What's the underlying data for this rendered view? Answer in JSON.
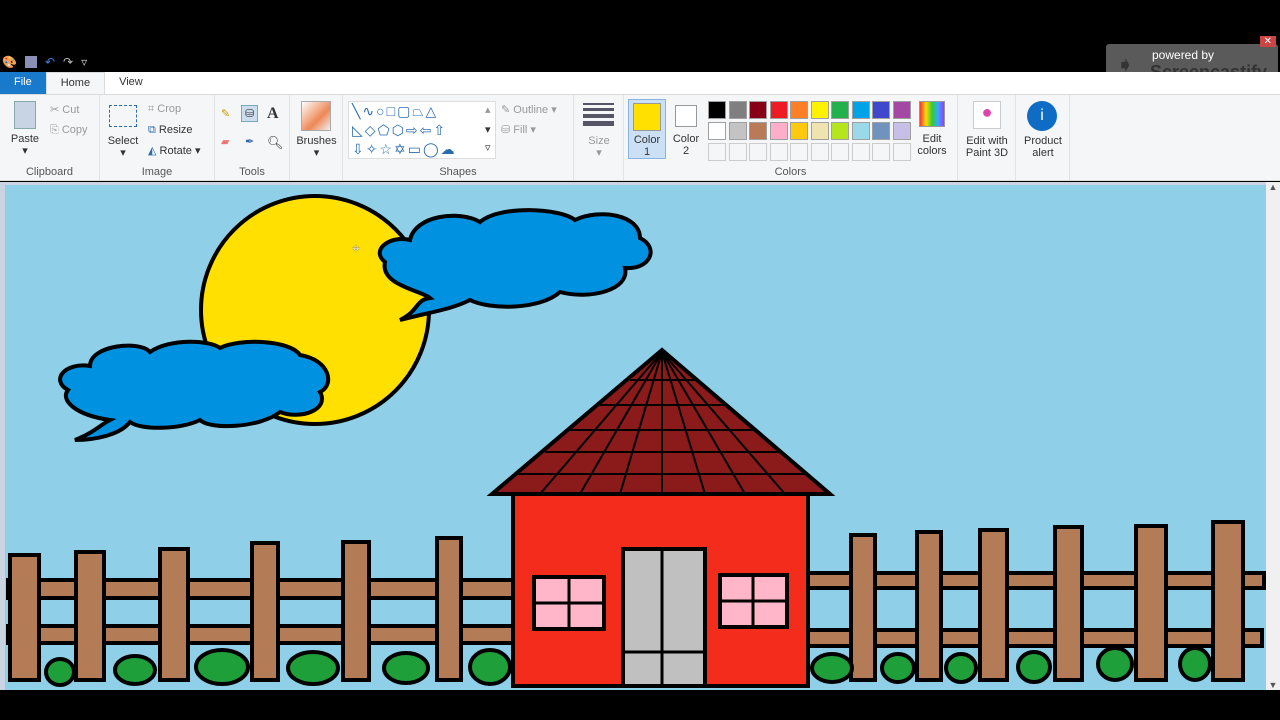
{
  "quick_access": {
    "icons": [
      "paint-app-icon",
      "save-icon",
      "undo-icon",
      "redo-icon",
      "customize-icon"
    ]
  },
  "tabs": [
    {
      "label": "File"
    },
    {
      "label": "Home"
    },
    {
      "label": "View"
    }
  ],
  "clipboard": {
    "paste": "Paste",
    "cut": "Cut",
    "copy": "Copy",
    "label": "Clipboard"
  },
  "image": {
    "select": "Select",
    "crop": "Crop",
    "resize": "Resize",
    "rotate": "Rotate",
    "label": "Image"
  },
  "tools": {
    "label": "Tools"
  },
  "brushes": {
    "label": "Brushes"
  },
  "shapes": {
    "outline": "Outline",
    "fill": "Fill",
    "label": "Shapes"
  },
  "size": {
    "label": "Size"
  },
  "colors": {
    "color1": "Color",
    "color1_num": "1",
    "color2": "Color",
    "color2_num": "2",
    "edit": "Edit",
    "edit2": "colors",
    "label": "Colors",
    "color1_value": "#ffe000",
    "color2_value": "#ffffff",
    "palette_row1": [
      "#000000",
      "#7f7f7f",
      "#880015",
      "#ed1c24",
      "#ff7f27",
      "#fff200",
      "#22b14c",
      "#00a2e8",
      "#3f48cc",
      "#a349a4"
    ],
    "palette_row2": [
      "#ffffff",
      "#c3c3c3",
      "#b97a57",
      "#ffaec9",
      "#ffc90e",
      "#efe4b0",
      "#b5e61d",
      "#99d9ea",
      "#7092be",
      "#c8bfe7"
    ]
  },
  "paint3d": {
    "l1": "Edit with",
    "l2": "Paint 3D"
  },
  "product_alert": {
    "l1": "Product",
    "l2": "alert"
  },
  "watermark": {
    "l1": "powered by",
    "l2": "Screencastify"
  }
}
